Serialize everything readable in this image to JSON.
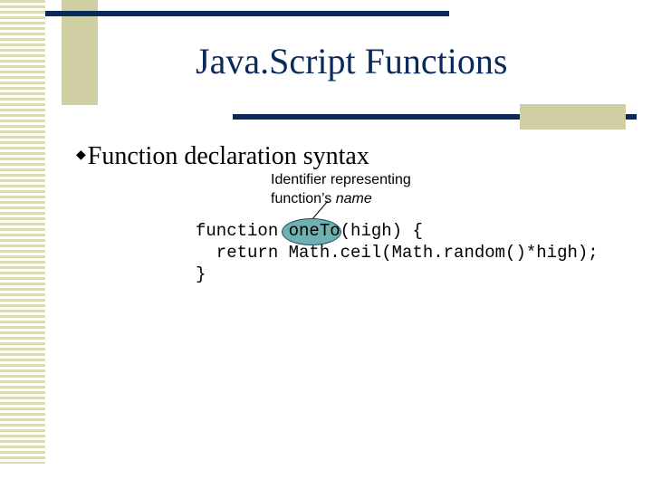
{
  "slide": {
    "title": "Java.Script Functions",
    "bullet": {
      "icon": "diamond-bullet-icon",
      "text": "Function declaration syntax"
    },
    "annotation": {
      "line1": "Identifier representing",
      "line2_prefix": "function’s ",
      "line2_italic": "name"
    },
    "code": {
      "line1_before": "function ",
      "highlight": "oneTo",
      "line1_after": "(high) {",
      "line2": "  return Math.ceil(Math.random()*high);",
      "line3": "}"
    },
    "colors": {
      "title": "#0b2a5c",
      "rule": "#0b2a5c",
      "accent_block": "#cfcfa3",
      "highlight_fill": "#6fb0b0"
    }
  }
}
